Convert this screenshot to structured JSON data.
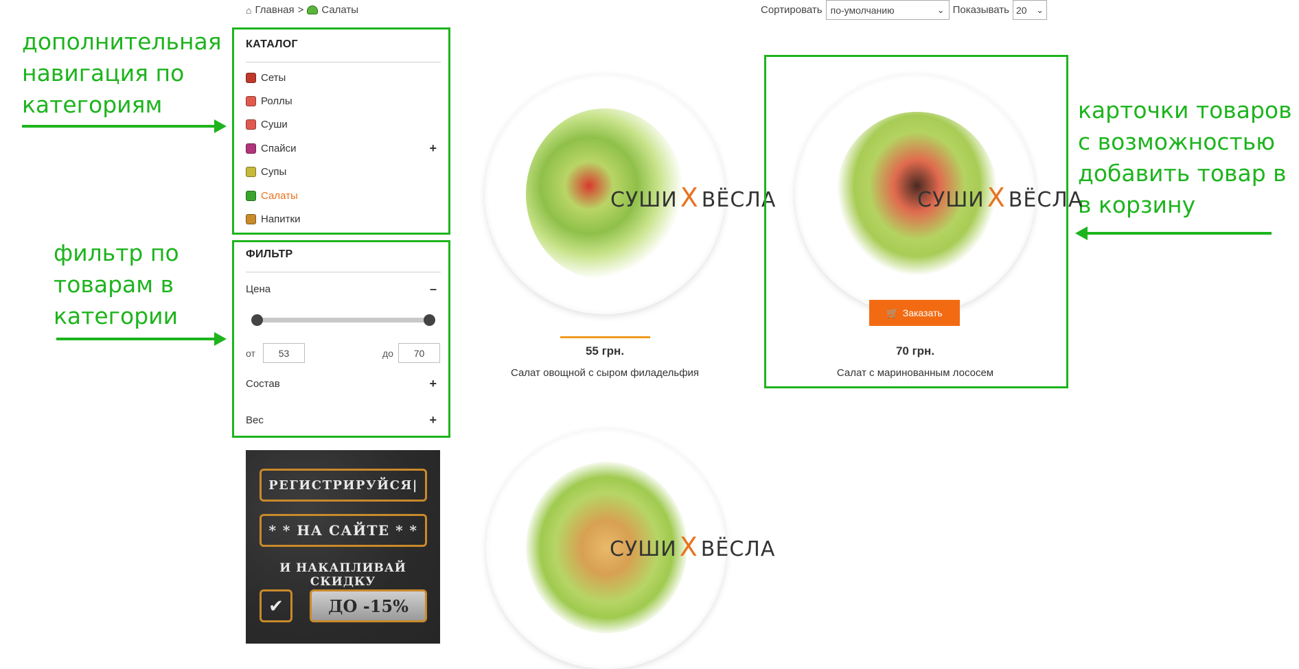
{
  "breadcrumb": {
    "home": "Главная",
    "separator": ">",
    "current": "Салаты"
  },
  "sort": {
    "sort_label": "Сортировать",
    "sort_value": "по-умолчанию",
    "show_label": "Показывать",
    "show_value": "20"
  },
  "catalog": {
    "title": "КАТАЛОГ",
    "items": [
      {
        "label": "Сеты",
        "icon": "sushi-set-icon",
        "color": "#c0392b"
      },
      {
        "label": "Роллы",
        "icon": "roll-icon",
        "color": "#e05a4f"
      },
      {
        "label": "Суши",
        "icon": "sushi-icon",
        "color": "#e05a4f"
      },
      {
        "label": "Спайси",
        "icon": "spicy-icon",
        "color": "#b0357a",
        "expand": "+"
      },
      {
        "label": "Супы",
        "icon": "soup-icon",
        "color": "#c7b93a"
      },
      {
        "label": "Салаты",
        "icon": "salad-icon",
        "color": "#3aa52d"
      },
      {
        "label": "Напитки",
        "icon": "drink-icon",
        "color": "#c88a2a"
      }
    ]
  },
  "filter": {
    "title": "ФИЛЬТР",
    "price_label": "Цена",
    "price_toggle": "–",
    "from_label": "от",
    "from_value": "53",
    "to_label": "до",
    "to_value": "70",
    "composition_label": "Состав",
    "composition_toggle": "+",
    "weight_label": "Вес",
    "weight_toggle": "+"
  },
  "promo": {
    "line1": "РЕГИСТРИРУЙСЯ|",
    "line2": "* * НА САЙТЕ * *",
    "line3": "И НАКАПЛИВАЙ СКИДКУ",
    "discount": "ДО -15%"
  },
  "products": [
    {
      "price": "55 грн.",
      "name": "Салат овощной с сыром филадельфия"
    },
    {
      "price": "70 грн.",
      "name": "Салат с маринованным лососем",
      "order_label": "Заказать"
    }
  ],
  "watermark": {
    "left": "СУШИ",
    "x": "X",
    "right": "ВЁСЛА"
  },
  "annotations": {
    "nav": "дополнительная\nнавигация по\nкатегориям",
    "filter": "фильтр по\nтоварам в\nкатегории",
    "cards": "карточки товаров\nс возможностью\nдобавить товар в\nв корзину"
  },
  "colors": {
    "accent": "#e8731f",
    "annotation": "#1db41d",
    "order_button": "#f26b12"
  }
}
